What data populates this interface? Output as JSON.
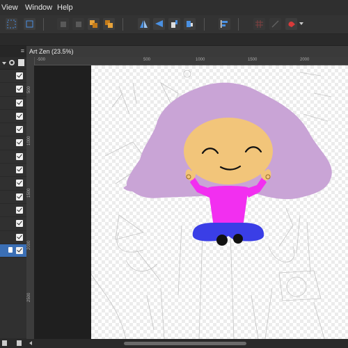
{
  "menu": {
    "items": [
      "View",
      "Window",
      "Help"
    ]
  },
  "document": {
    "tab_title": "Art Zen (23.5%)"
  },
  "rulers": {
    "horizontal": [
      "-500",
      "500",
      "1000",
      "1500",
      "2000"
    ],
    "vertical": [
      "500",
      "1000",
      "1500",
      "2000",
      "2500"
    ]
  },
  "layers": {
    "row_count": 14,
    "selected_index": 13
  },
  "colors": {
    "hair": "#c9a4d6",
    "skin": "#f2c57a",
    "shirt": "#f22ff0",
    "pants": "#3a3ee6",
    "shoes": "#111111",
    "selection": "#3b6fb5"
  },
  "icons": {
    "toolbar": [
      "select-icon",
      "transform-icon",
      "arrange-icon",
      "arrange-icon",
      "arrange-icon",
      "arrange-icon",
      "flip-horizontal-icon",
      "flip-vertical-icon",
      "rotate-left-icon",
      "rotate-right-icon",
      "align-icon",
      "grid-icon",
      "snap-icon",
      "magnet-icon"
    ],
    "layers_panel": [
      "menu-icon",
      "settings-icon",
      "add-layer-icon"
    ]
  }
}
